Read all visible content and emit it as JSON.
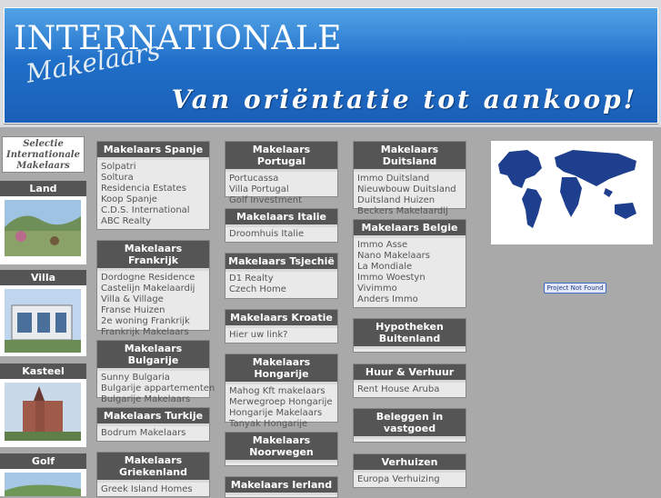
{
  "header": {
    "title": "INTERNATIONALE",
    "subtitle": "Makelaars",
    "tagline": "Van oriëntatie tot aankoop!"
  },
  "sidebar": {
    "select_title": [
      "Selectie",
      "Internationale",
      "Makelaars"
    ],
    "categories": [
      {
        "label": "Land"
      },
      {
        "label": "Villa"
      },
      {
        "label": "Kasteel"
      },
      {
        "label": "Golf"
      }
    ]
  },
  "col1": [
    {
      "title": "Makelaars Spanje",
      "items": [
        "Solpatri",
        "Soltura",
        "Residencia Estates",
        "Koop Spanje",
        "C.D.S. International",
        "ABC Realty"
      ]
    },
    {
      "title": "Makelaars Frankrijk",
      "items": [
        "Dordogne Residence",
        "Castelijn Makelaardij",
        "Villa & Village",
        "Franse Huizen",
        "2e woning Frankrijk",
        "Frankrijk Makelaars"
      ]
    },
    {
      "title": "Makelaars Bulgarije",
      "items": [
        "Sunny Bulgaria",
        "Bulgarije appartementen",
        "Bulgarije Makelaars"
      ]
    },
    {
      "title": "Makelaars Turkije",
      "items": [
        "Bodrum Makelaars"
      ]
    },
    {
      "title": "Makelaars Griekenland",
      "items": [
        "Greek Island Homes"
      ]
    }
  ],
  "col2": [
    {
      "title": "Makelaars Portugal",
      "items": [
        "Portucassa",
        "Villa Portugal",
        "Golf Investment"
      ]
    },
    {
      "title": "Makelaars Italie",
      "items": [
        "Droomhuis Italie"
      ]
    },
    {
      "title": "Makelaars Tsjechië",
      "items": [
        "D1 Realty",
        "Czech Home"
      ]
    },
    {
      "title": "Makelaars Kroatie",
      "items": [
        "Hier uw link?"
      ]
    },
    {
      "title": "Makelaars Hongarije",
      "items": [
        "Mahog Kft makelaars",
        "Merwegroep Hongarije",
        "Hongarije Makelaars",
        "Tanyak Hongarije"
      ]
    },
    {
      "title": "Makelaars Noorwegen",
      "items": []
    },
    {
      "title": "Makelaars Ierland",
      "items": []
    }
  ],
  "col3": [
    {
      "title": "Makelaars Duitsland",
      "items": [
        "Immo Duitsland",
        "Nieuwbouw Duitsland",
        "Duitsland Huizen",
        "Beckers Makelaardij"
      ]
    },
    {
      "title": "Makelaars Belgie",
      "items": [
        "Immo Asse",
        "Nano Makelaars",
        "La Mondiale",
        "Immo Woestyn",
        "Vivimmo",
        "Anders Immo"
      ]
    },
    {
      "title": "Hypotheken Buitenland",
      "items": []
    },
    {
      "title": "Huur & Verhuur",
      "items": [
        "Rent House Aruba"
      ]
    },
    {
      "title": "Beleggen in vastgoed",
      "items": []
    },
    {
      "title": "Verhuizen",
      "items": [
        "Europa Verhuizing"
      ]
    }
  ],
  "right": {
    "project_label": "Project Not Found"
  }
}
